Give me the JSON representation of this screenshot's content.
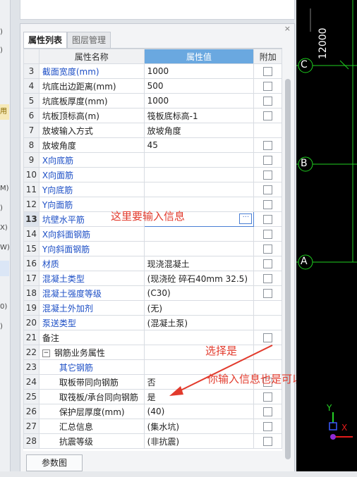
{
  "left_strip": {
    "items": [
      ")",
      ")",
      "用",
      "M)",
      ")",
      "X)",
      "W)",
      "0)",
      ")"
    ]
  },
  "panel": {
    "tabs": [
      {
        "label": "属性列表"
      },
      {
        "label": "图层管理"
      }
    ],
    "close_label": "×",
    "headers": {
      "num": "",
      "name": "属性名称",
      "value": "属性值",
      "extra": "附加"
    },
    "rows": [
      {
        "num": "3",
        "name": "截面宽度(mm)",
        "value": "1000",
        "checkbox": true
      },
      {
        "num": "4",
        "name": "坑底出边距离(mm)",
        "value": "500",
        "checkbox": true
      },
      {
        "num": "5",
        "name": "坑底板厚度(mm)",
        "value": "1000",
        "checkbox": true
      },
      {
        "num": "6",
        "name": "坑板顶标高(m)",
        "value": "筏板底标高-1",
        "checkbox": true
      },
      {
        "num": "7",
        "name": "放坡输入方式",
        "value": "放坡角度",
        "checkbox": false
      },
      {
        "num": "8",
        "name": "放坡角度",
        "value": "45",
        "checkbox": true
      },
      {
        "num": "9",
        "name": "X向底筋",
        "value": "",
        "checkbox": true
      },
      {
        "num": "10",
        "name": "X向面筋",
        "value": "",
        "checkbox": true
      },
      {
        "num": "11",
        "name": "Y向底筋",
        "value": "",
        "checkbox": true
      },
      {
        "num": "12",
        "name": "Y向面筋",
        "value": "",
        "checkbox": true
      },
      {
        "num": "13",
        "name": "坑壁水平筋",
        "value": "",
        "checkbox": true
      },
      {
        "num": "14",
        "name": "X向斜面钢筋",
        "value": "",
        "checkbox": true
      },
      {
        "num": "15",
        "name": "Y向斜面钢筋",
        "value": "",
        "checkbox": true
      },
      {
        "num": "16",
        "name": "材质",
        "value": "现浇混凝土",
        "checkbox": true
      },
      {
        "num": "17",
        "name": "混凝土类型",
        "value": "(现浇砼 碎石40mm 32.5)",
        "checkbox": true
      },
      {
        "num": "18",
        "name": "混凝土强度等级",
        "value": "(C30)",
        "checkbox": true
      },
      {
        "num": "19",
        "name": "混凝土外加剂",
        "value": "(无)",
        "checkbox": false
      },
      {
        "num": "20",
        "name": "泵送类型",
        "value": "(混凝土泵)",
        "checkbox": false
      },
      {
        "num": "21",
        "name": "备注",
        "value": "",
        "checkbox": true
      },
      {
        "num": "22",
        "name": "钢筋业务属性",
        "value": "",
        "checkbox": false
      },
      {
        "num": "23",
        "name": "其它钢筋",
        "value": "",
        "checkbox": false
      },
      {
        "num": "24",
        "name": "取板带同向钢筋",
        "value": "否",
        "checkbox": true
      },
      {
        "num": "25",
        "name": "取筏板/承台同向钢筋",
        "value": "是",
        "checkbox": true
      },
      {
        "num": "26",
        "name": "保护层厚度(mm)",
        "value": "(40)",
        "checkbox": true
      },
      {
        "num": "27",
        "name": "汇总信息",
        "value": "(集水坑)",
        "checkbox": true
      },
      {
        "num": "28",
        "name": "抗震等级",
        "value": "(非抗震)",
        "checkbox": true
      }
    ],
    "editor_ellipsis": "···",
    "tree_toggle": "−",
    "param_button": "参数图"
  },
  "annotations": {
    "input_here": "这里要输入信息",
    "choose_yes": "选择是",
    "also_ok": "你输入信息也是可以的"
  },
  "canvas": {
    "axis_labels": [
      "C",
      "B",
      "A"
    ],
    "dimension": "12000",
    "ucs_y": "Y",
    "ucs_x": "X"
  },
  "colors": {
    "blue_property": "#1d4fc6",
    "annotation": "#e23a2c",
    "grid_line": "#1fd11f",
    "header_value": "#6aa8e0"
  }
}
